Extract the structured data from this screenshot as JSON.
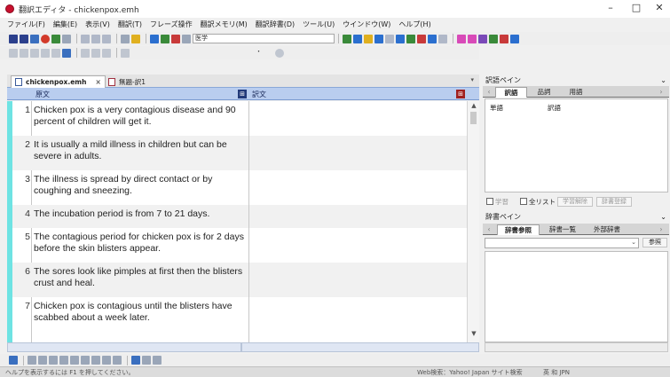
{
  "window": {
    "title": "翻訳エディタ - chickenpox.emh",
    "minimize_glyph": "–",
    "maximize_glyph": "□",
    "close_glyph": "✕"
  },
  "menu": [
    "ファイル(F)",
    "編集(E)",
    "表示(V)",
    "翻訳(T)",
    "フレーズ操作",
    "翻訳メモリ(M)",
    "翻訳辞書(D)",
    "ツール(U)",
    "ウインドウ(W)",
    "ヘルプ(H)"
  ],
  "toolbar": {
    "domain_value": "医学",
    "zoom_value": "・"
  },
  "tabs": {
    "active": "chickenpox.emh",
    "close_glyph": "×",
    "untitled": "無題-訳1"
  },
  "columns": {
    "source": "原文",
    "target": "訳文"
  },
  "segments": [
    {
      "num": "1",
      "text": "Chicken pox is a very contagious disease and 90 percent of children will get it."
    },
    {
      "num": "2",
      "text": "It is usually a mild illness in children but can be severe in adults."
    },
    {
      "num": "3",
      "text": "The illness is spread by direct contact or by coughing and sneezing."
    },
    {
      "num": "4",
      "text": "The incubation period is from 7 to 21 days."
    },
    {
      "num": "5",
      "text": "The contagious period for chicken pox is for 2 days before the skin blisters appear."
    },
    {
      "num": "6",
      "text": "The sores look like pimples at first then the blisters crust and heal."
    },
    {
      "num": "7",
      "text": "Chicken pox is contagious until the blisters have scabbed about a week later."
    }
  ],
  "word_pane": {
    "title": "訳語ペイン",
    "tabs": [
      "訳語",
      "品詞",
      "用語"
    ],
    "headers": [
      "単語",
      "訳語"
    ],
    "checkbox_1": "学習",
    "checkbox_2": "全リスト",
    "btn_1": "学習解除",
    "btn_2": "辞書登録"
  },
  "dict_pane": {
    "title": "辞書ペイン",
    "tabs": [
      "辞書参照",
      "辞書一覧",
      "外部辞書"
    ],
    "search_button": "参照"
  },
  "status": {
    "left": "ヘルプを表示するには F1 を押してください。",
    "center": "Web検索：Yahoo! Japan サイト検索",
    "right": "英 和 JPN"
  }
}
